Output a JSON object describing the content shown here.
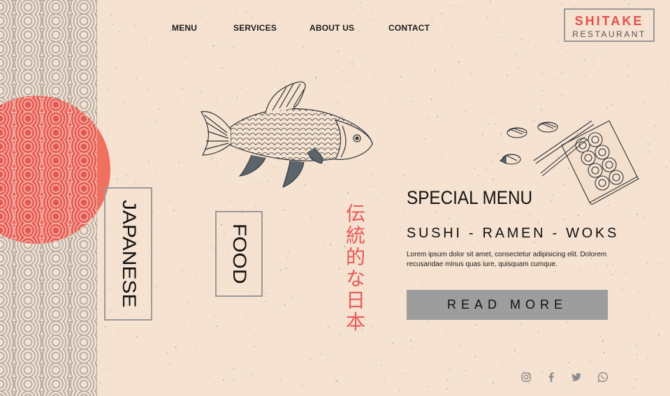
{
  "nav": {
    "items": [
      "MENU",
      "SERVICES",
      "ABOUT US",
      "CONTACT"
    ]
  },
  "logo": {
    "title": "SHITAKE",
    "subtitle": "RESTAURANT"
  },
  "hero": {
    "word_1": "JAPANESE",
    "word_2": "FOOD",
    "jp_text": "伝統的な日本"
  },
  "special": {
    "title": "SPECIAL MENU",
    "subtitle": "SUSHI - RAMEN - WOKS",
    "description": "Lorem ipsum dolor sit amet, consectetur adipisicing elit. Dolorem recusandae minus quas iure, quisquam cumque.",
    "button_label": "READ MORE"
  },
  "social": [
    "instagram-icon",
    "facebook-icon",
    "twitter-icon",
    "whatsapp-icon"
  ],
  "colors": {
    "background": "#f6e2d0",
    "accent": "#e85a58",
    "button": "#9d9d9d",
    "pattern": "#a9a29a"
  }
}
